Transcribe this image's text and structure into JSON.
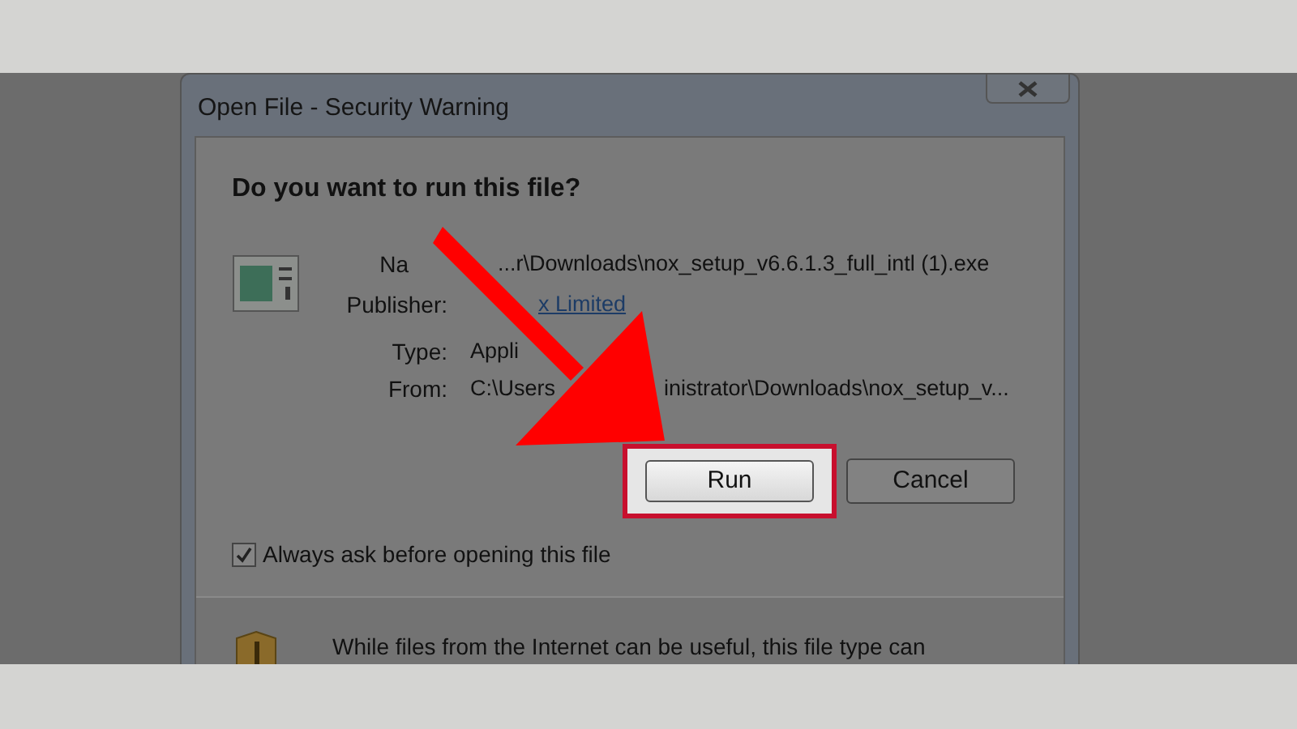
{
  "window": {
    "title": "Open File - Security Warning"
  },
  "heading": "Do you want to run this file?",
  "fields": [
    {
      "label": "Na",
      "kind": "text",
      "values": [
        "...r\\Downloads\\nox_setup_v6.6.1.3_full_intl (1).exe"
      ]
    },
    {
      "label": "Publisher:",
      "kind": "link",
      "values": [
        "x Limited"
      ]
    },
    {
      "label": "Type:",
      "kind": "text",
      "values": [
        "Appli"
      ]
    },
    {
      "label": "From:",
      "kind": "text",
      "values": [
        "C:\\Users",
        "inistrator\\Downloads\\nox_setup_v..."
      ]
    }
  ],
  "buttons": [
    {
      "label": "Run",
      "highlighted": true
    },
    {
      "label": "Cancel",
      "highlighted": false
    }
  ],
  "checkbox": {
    "label": "Always ask before opening this file",
    "checked": true
  },
  "warning": "While files from the Internet can be useful, this file type can"
}
